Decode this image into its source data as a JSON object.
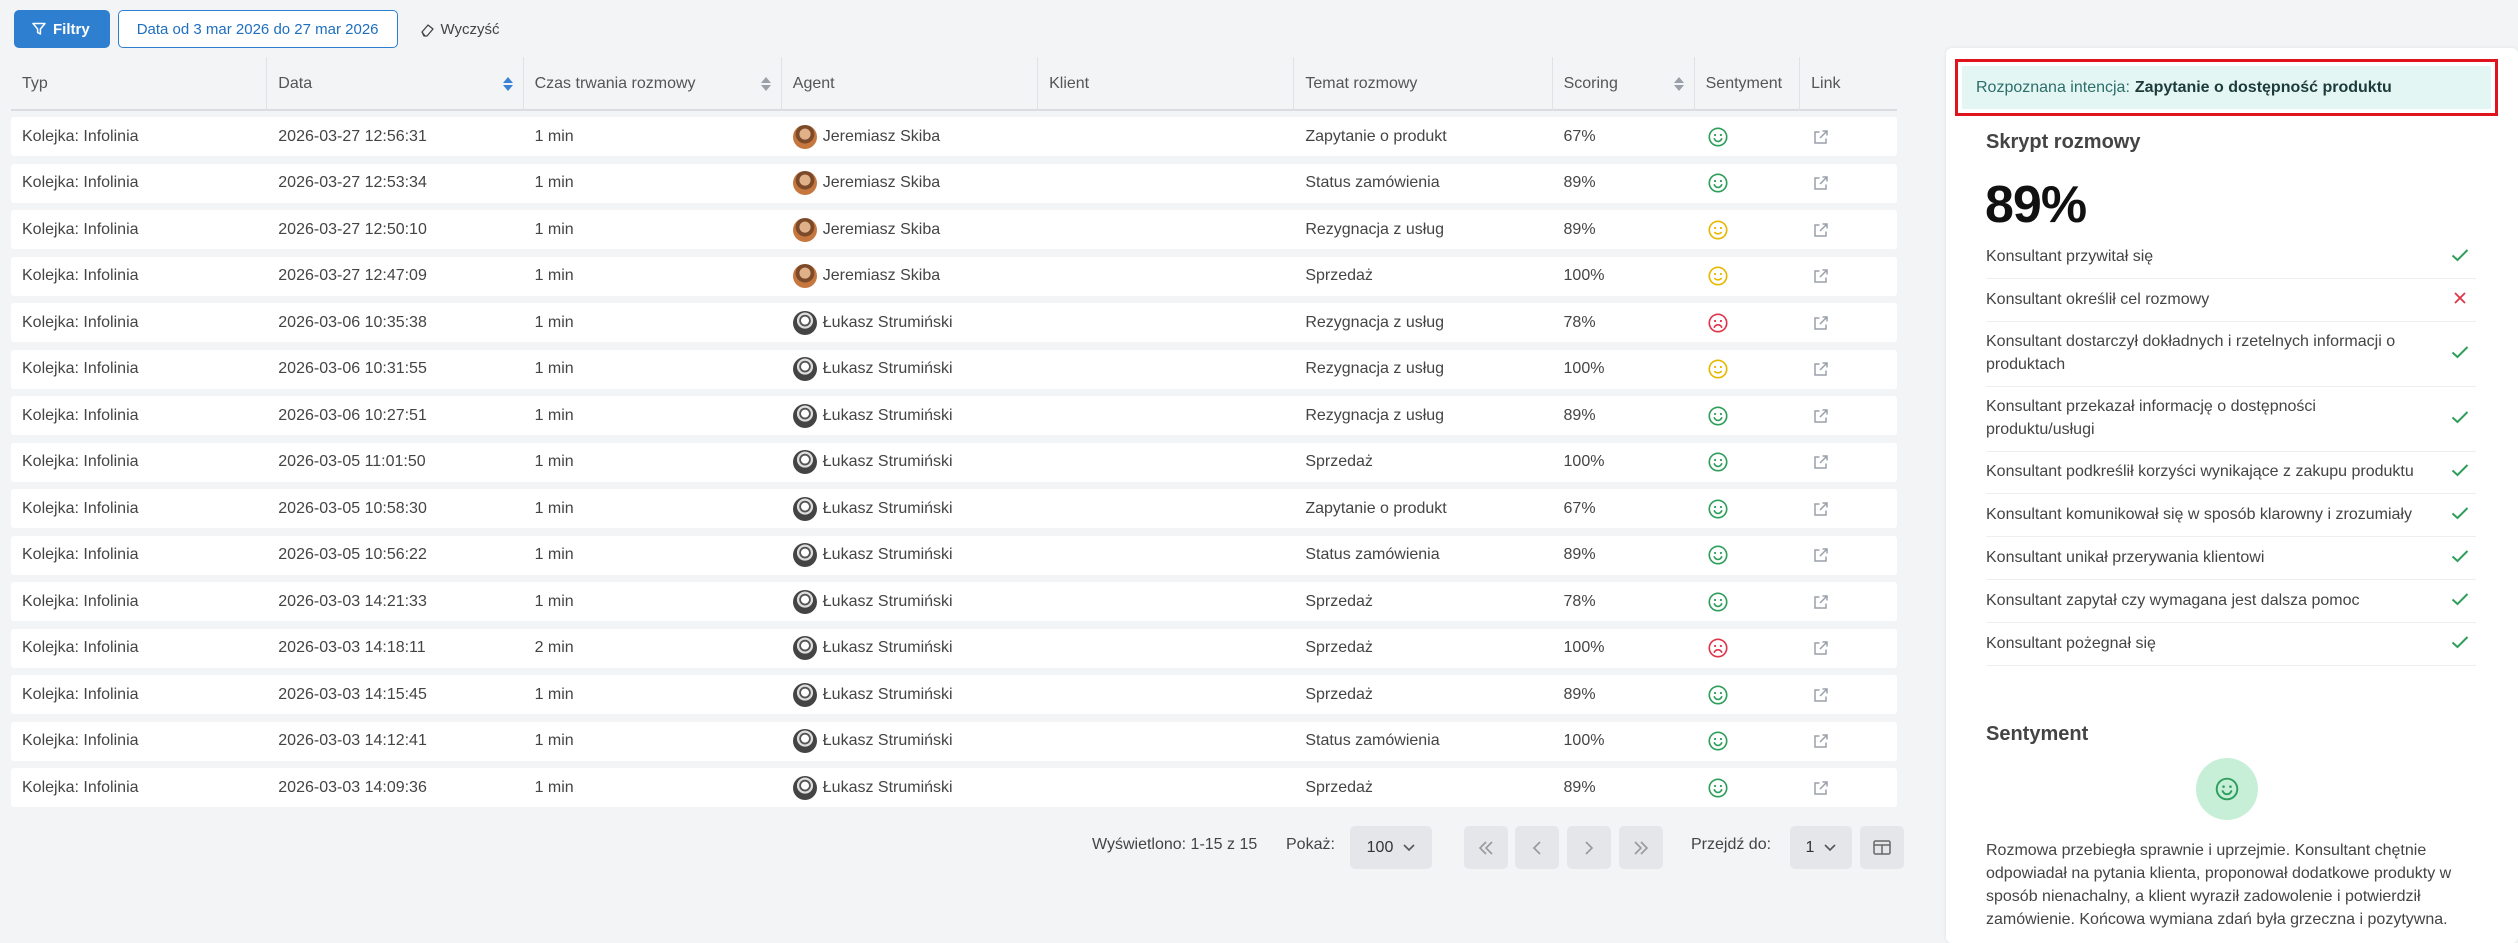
{
  "toolbar": {
    "filters_label": "Filtry",
    "date_label": "Data od 3 mar 2026 do 27 mar 2026",
    "clear_label": "Wyczyść"
  },
  "columns": [
    {
      "key": "typ",
      "label": "Typ",
      "sortable": false
    },
    {
      "key": "data",
      "label": "Data",
      "sortable": true,
      "active": true
    },
    {
      "key": "czas",
      "label": "Czas trwania rozmowy",
      "sortable": true
    },
    {
      "key": "agent",
      "label": "Agent",
      "sortable": false
    },
    {
      "key": "klient",
      "label": "Klient",
      "sortable": false
    },
    {
      "key": "temat",
      "label": "Temat rozmowy",
      "sortable": false
    },
    {
      "key": "scoring",
      "label": "Scoring",
      "sortable": true
    },
    {
      "key": "sentyment",
      "label": "Sentyment",
      "sortable": false
    },
    {
      "key": "link",
      "label": "Link",
      "sortable": false
    }
  ],
  "rows": [
    {
      "typ": "Kolejka: Infolinia",
      "data": "2026-03-27 12:56:31",
      "czas": "1 min",
      "agent": "Jeremiasz Skiba",
      "avatar": "js",
      "klient": "",
      "temat": "Zapytanie o produkt",
      "scoring": "67%",
      "sentyment": "positive"
    },
    {
      "typ": "Kolejka: Infolinia",
      "data": "2026-03-27 12:53:34",
      "czas": "1 min",
      "agent": "Jeremiasz Skiba",
      "avatar": "js",
      "klient": "",
      "temat": "Status zamówienia",
      "scoring": "89%",
      "sentyment": "positive"
    },
    {
      "typ": "Kolejka: Infolinia",
      "data": "2026-03-27 12:50:10",
      "czas": "1 min",
      "agent": "Jeremiasz Skiba",
      "avatar": "js",
      "klient": "",
      "temat": "Rezygnacja z usług",
      "scoring": "89%",
      "sentyment": "neutral"
    },
    {
      "typ": "Kolejka: Infolinia",
      "data": "2026-03-27 12:47:09",
      "czas": "1 min",
      "agent": "Jeremiasz Skiba",
      "avatar": "js",
      "klient": "",
      "temat": "Sprzedaż",
      "scoring": "100%",
      "sentyment": "neutral"
    },
    {
      "typ": "Kolejka: Infolinia",
      "data": "2026-03-06 10:35:38",
      "czas": "1 min",
      "agent": "Łukasz Strumiński",
      "avatar": "ls",
      "klient": "",
      "temat": "Rezygnacja z usług",
      "scoring": "78%",
      "sentyment": "negative"
    },
    {
      "typ": "Kolejka: Infolinia",
      "data": "2026-03-06 10:31:55",
      "czas": "1 min",
      "agent": "Łukasz Strumiński",
      "avatar": "ls",
      "klient": "",
      "temat": "Rezygnacja z usług",
      "scoring": "100%",
      "sentyment": "neutral"
    },
    {
      "typ": "Kolejka: Infolinia",
      "data": "2026-03-06 10:27:51",
      "czas": "1 min",
      "agent": "Łukasz Strumiński",
      "avatar": "ls",
      "klient": "",
      "temat": "Rezygnacja z usług",
      "scoring": "89%",
      "sentyment": "positive"
    },
    {
      "typ": "Kolejka: Infolinia",
      "data": "2026-03-05 11:01:50",
      "czas": "1 min",
      "agent": "Łukasz Strumiński",
      "avatar": "ls",
      "klient": "",
      "temat": "Sprzedaż",
      "scoring": "100%",
      "sentyment": "positive"
    },
    {
      "typ": "Kolejka: Infolinia",
      "data": "2026-03-05 10:58:30",
      "czas": "1 min",
      "agent": "Łukasz Strumiński",
      "avatar": "ls",
      "klient": "",
      "temat": "Zapytanie o produkt",
      "scoring": "67%",
      "sentyment": "positive"
    },
    {
      "typ": "Kolejka: Infolinia",
      "data": "2026-03-05 10:56:22",
      "czas": "1 min",
      "agent": "Łukasz Strumiński",
      "avatar": "ls",
      "klient": "",
      "temat": "Status zamówienia",
      "scoring": "89%",
      "sentyment": "positive"
    },
    {
      "typ": "Kolejka: Infolinia",
      "data": "2026-03-03 14:21:33",
      "czas": "1 min",
      "agent": "Łukasz Strumiński",
      "avatar": "ls",
      "klient": "",
      "temat": "Sprzedaż",
      "scoring": "78%",
      "sentyment": "positive"
    },
    {
      "typ": "Kolejka: Infolinia",
      "data": "2026-03-03 14:18:11",
      "czas": "2 min",
      "agent": "Łukasz Strumiński",
      "avatar": "ls",
      "klient": "",
      "temat": "Sprzedaż",
      "scoring": "100%",
      "sentyment": "negative"
    },
    {
      "typ": "Kolejka: Infolinia",
      "data": "2026-03-03 14:15:45",
      "czas": "1 min",
      "agent": "Łukasz Strumiński",
      "avatar": "ls",
      "klient": "",
      "temat": "Sprzedaż",
      "scoring": "89%",
      "sentyment": "positive"
    },
    {
      "typ": "Kolejka: Infolinia",
      "data": "2026-03-03 14:12:41",
      "czas": "1 min",
      "agent": "Łukasz Strumiński",
      "avatar": "ls",
      "klient": "",
      "temat": "Status zamówienia",
      "scoring": "100%",
      "sentyment": "positive"
    },
    {
      "typ": "Kolejka: Infolinia",
      "data": "2026-03-03 14:09:36",
      "czas": "1 min",
      "agent": "Łukasz Strumiński",
      "avatar": "ls",
      "klient": "",
      "temat": "Sprzedaż",
      "scoring": "89%",
      "sentyment": "positive"
    }
  ],
  "pagination": {
    "info": "Wyświetlono: 1-15 z 15",
    "show_label": "Pokaż:",
    "page_size": "100",
    "goto_label": "Przejdź do:",
    "page": "1"
  },
  "panel": {
    "intent_label": "Rozpoznana intencja:",
    "intent_value": "Zapytanie o dostępność produktu",
    "script_title": "Skrypt rozmowy",
    "score": "89%",
    "checklist": [
      {
        "text": "Konsultant przywitał się",
        "ok": true
      },
      {
        "text": "Konsultant określił cel rozmowy",
        "ok": false
      },
      {
        "text": "Konsultant dostarczył dokładnych i rzetelnych informacji o produktach",
        "ok": true
      },
      {
        "text": "Konsultant przekazał informację o dostępności produktu/usługi",
        "ok": true
      },
      {
        "text": "Konsultant podkreślił korzyści wynikające z zakupu produktu",
        "ok": true
      },
      {
        "text": "Konsultant komunikował się w sposób klarowny i zrozumiały",
        "ok": true
      },
      {
        "text": "Konsultant unikał przerywania klientowi",
        "ok": true
      },
      {
        "text": "Konsultant zapytał czy wymagana jest dalsza pomoc",
        "ok": true
      },
      {
        "text": "Konsultant pożegnał się",
        "ok": true
      }
    ],
    "sentiment_title": "Sentyment",
    "sentiment": "positive",
    "sentiment_text": "Rozmowa przebiegła sprawnie i uprzejmie. Konsultant chętnie odpowiadał na pytania klienta, proponował dodatkowe produkty w sposób nienachalny, a klient wyraził zadowolenie i potwierdził zamówienie. Końcowa wymiana zdań była grzeczna i pozytywna."
  },
  "colors": {
    "accent": "#2f7fd0",
    "positive": "#2e9e5b",
    "neutral": "#e6b800",
    "negative": "#e0344a",
    "highlight": "#e0141c"
  }
}
